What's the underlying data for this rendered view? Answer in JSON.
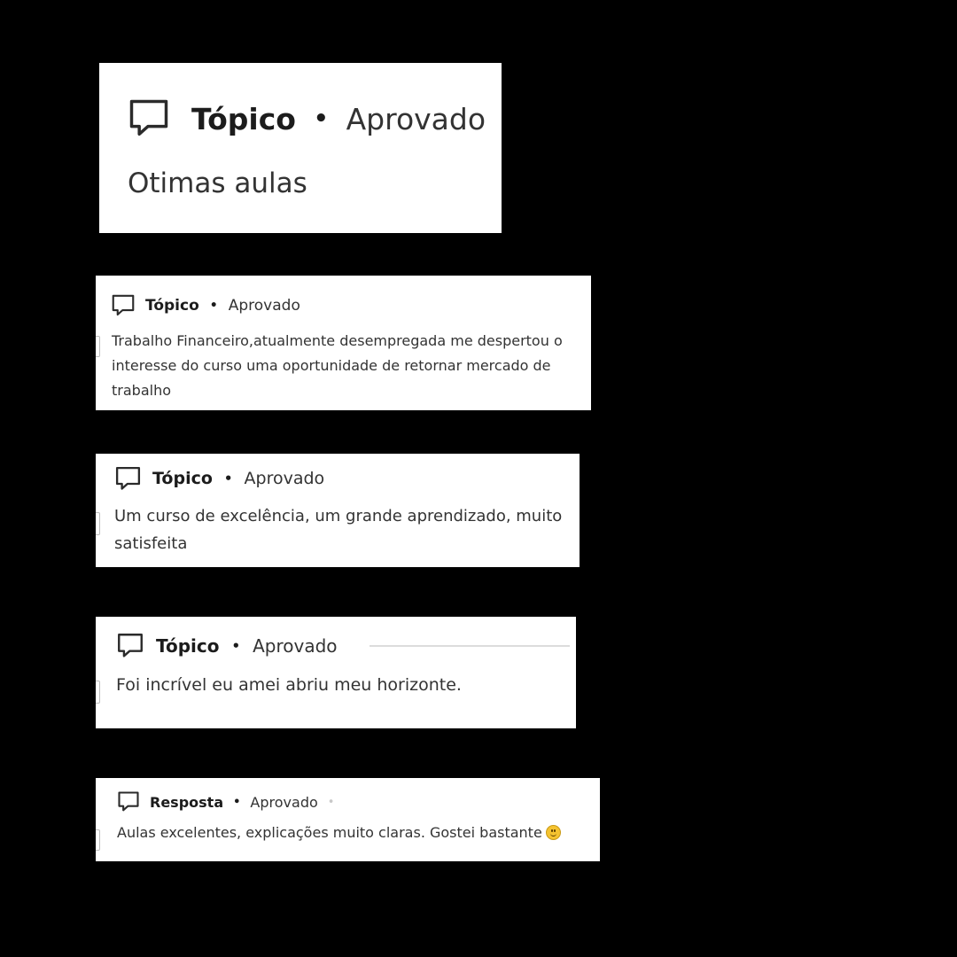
{
  "cards": [
    {
      "type": "Tópico",
      "sep": "•",
      "status": "Aprovado",
      "trail": "•",
      "text": "Otimas aulas"
    },
    {
      "type": "Tópico",
      "sep": "•",
      "status": "Aprovado",
      "text_lines": [
        "Trabalho Financeiro,atualmente desempregada me despertou o",
        "interesse do curso uma oportunidade de retornar mercado de",
        "trabalho"
      ]
    },
    {
      "type": "Tópico",
      "sep": "•",
      "status": "Aprovado",
      "text_lines": [
        "Um curso de excelência, um grande aprendizado, muito",
        "satisfeita"
      ]
    },
    {
      "type": "Tópico",
      "sep": "•",
      "status": "Aprovado",
      "text": "Foi incrível eu amei abriu meu horizonte."
    },
    {
      "type": "Resposta",
      "sep": "•",
      "status": "Aprovado",
      "trail": "•",
      "text": "Aulas excelentes, explicações muito claras. Gostei bastante"
    }
  ],
  "icons": {
    "comment": "speech-bubble-icon",
    "emoji": "smiling-face-emoji"
  },
  "colors": {
    "page_background": "#000000",
    "card_background": "#ffffff"
  }
}
